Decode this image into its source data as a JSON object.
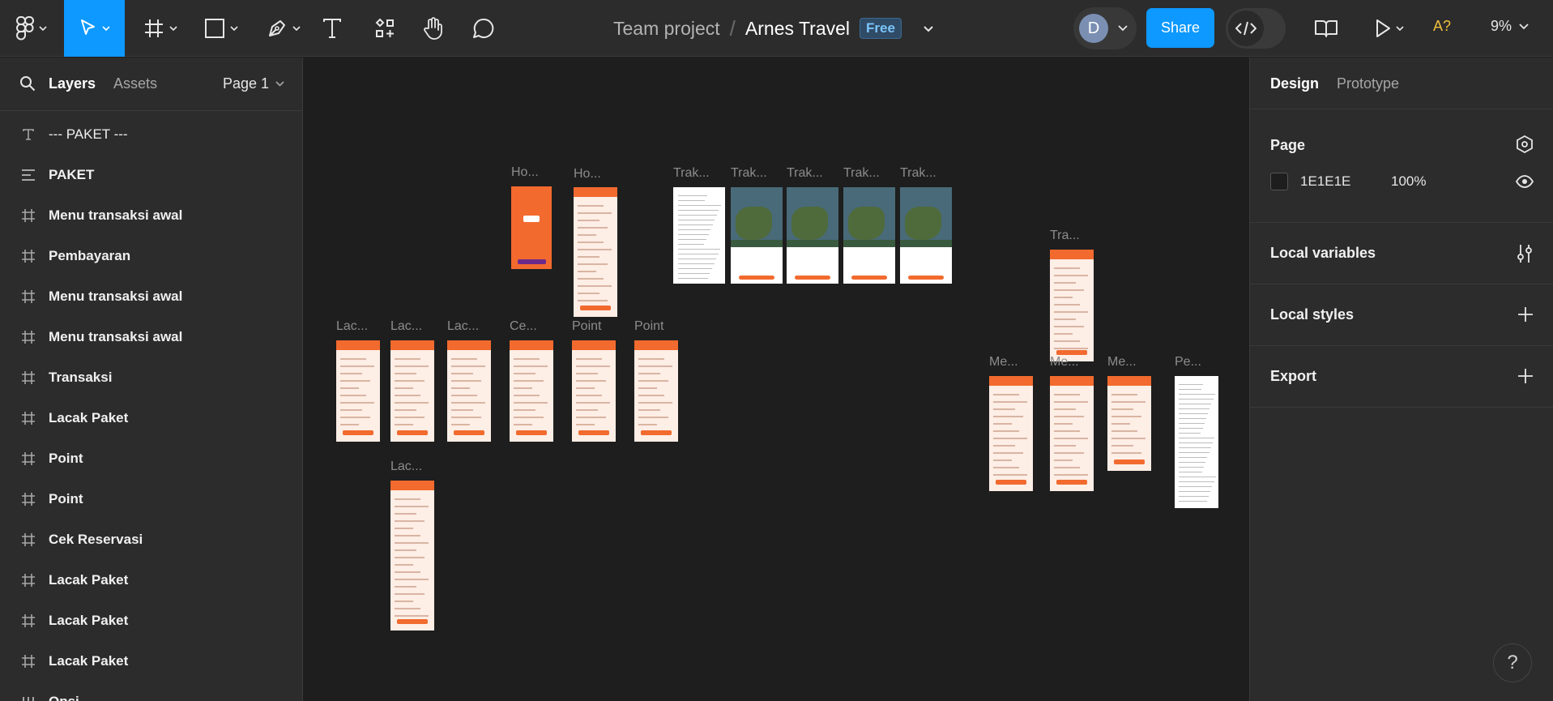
{
  "toolbar": {
    "file": {
      "team": "Team project",
      "separator": "/",
      "name": "Arnes Travel",
      "plan_badge": "Free"
    },
    "avatar_initial": "D",
    "share_label": "Share",
    "font_warning": "A?",
    "zoom": "9%",
    "icons": [
      "figma-menu-icon",
      "move-icon",
      "frame-icon",
      "rectangle-icon",
      "pen-icon",
      "text-icon",
      "components-icon",
      "hand-icon",
      "comment-icon",
      "dev-mode-icon",
      "library-icon",
      "play-icon"
    ]
  },
  "left_panel": {
    "tabs": {
      "layers": "Layers",
      "assets": "Assets"
    },
    "page_selector": "Page 1",
    "layers": [
      {
        "label": "--- PAKET ---",
        "icon": "text"
      },
      {
        "label": "PAKET",
        "icon": "auto-layout"
      },
      {
        "label": "Menu transaksi awal",
        "icon": "frame"
      },
      {
        "label": "Pembayaran",
        "icon": "frame"
      },
      {
        "label": "Menu transaksi awal",
        "icon": "frame"
      },
      {
        "label": "Menu transaksi awal",
        "icon": "frame"
      },
      {
        "label": "Transaksi",
        "icon": "frame"
      },
      {
        "label": "Lacak Paket",
        "icon": "frame"
      },
      {
        "label": "Point",
        "icon": "frame"
      },
      {
        "label": "Point",
        "icon": "frame"
      },
      {
        "label": "Cek Reservasi",
        "icon": "frame"
      },
      {
        "label": "Lacak Paket",
        "icon": "frame"
      },
      {
        "label": "Lacak Paket",
        "icon": "frame"
      },
      {
        "label": "Lacak Paket",
        "icon": "frame"
      },
      {
        "label": "Opsi",
        "icon": "bars"
      }
    ]
  },
  "canvas": {
    "frame_labels": [
      "Ho...",
      "Ho...",
      "Trak...",
      "Trak...",
      "Trak...",
      "Trak...",
      "Trak...",
      "Tra...",
      "Lac...",
      "Lac...",
      "Lac...",
      "Ce...",
      "Point",
      "Point",
      "Lac...",
      "Me...",
      "Me...",
      "Me...",
      "Pe..."
    ],
    "colors": {
      "canvas_bg": "#1E1E1E",
      "brand_orange": "#F26A2E",
      "frame_bg": "#FDEEE6"
    }
  },
  "right_panel": {
    "tabs": {
      "design": "Design",
      "prototype": "Prototype"
    },
    "page": {
      "title": "Page",
      "color_hex": "1E1E1E",
      "opacity": "100%"
    },
    "sections": [
      "Local variables",
      "Local styles",
      "Export"
    ]
  },
  "help_label": "?"
}
